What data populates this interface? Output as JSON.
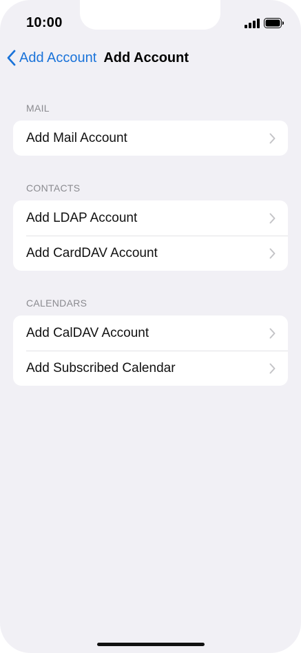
{
  "status_bar": {
    "time": "10:00",
    "icons": [
      "signal-icon",
      "battery-icon"
    ]
  },
  "nav": {
    "back_label": "Add Account",
    "title": "Add Account"
  },
  "sections": {
    "mail": {
      "header": "MAIL",
      "rows": [
        "Add Mail Account"
      ]
    },
    "contacts": {
      "header": "CONTACTS",
      "rows": [
        "Add LDAP Account",
        "Add CardDAV Account"
      ]
    },
    "calendars": {
      "header": "CALENDARS",
      "rows": [
        "Add CalDAV Account",
        "Add Subscribed Calendar"
      ]
    }
  },
  "colors": {
    "accent": "#1a73d9",
    "background": "#f1f0f5",
    "card": "#ffffff",
    "section_header": "#8a8a8f",
    "chevron": "#c4c4c7"
  }
}
